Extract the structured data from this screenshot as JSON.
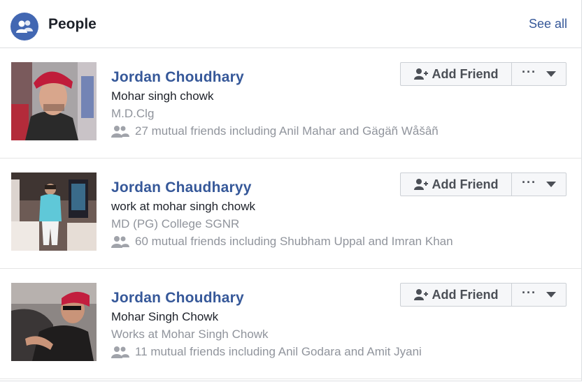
{
  "header": {
    "title": "People",
    "see_all": "See all"
  },
  "people": [
    {
      "name": "Jordan Choudhary",
      "line1": "Mohar singh chowk",
      "line2": "M.D.Clg",
      "mutual": "27 mutual friends including Anil Mahar and Gägäñ Wåšâñ",
      "add_friend_label": "Add Friend",
      "more_label": "···"
    },
    {
      "name": "Jordan Chaudharyy",
      "line1": "work at mohar singh chowk",
      "line2": "MD (PG) College SGNR",
      "mutual": "60 mutual friends including Shubham Uppal and Imran Khan",
      "add_friend_label": "Add Friend",
      "more_label": "···"
    },
    {
      "name": "Jordan Choudhary",
      "line1": "Mohar Singh Chowk",
      "line2": "Works at Mohar Singh Chowk",
      "mutual": "11 mutual friends including Anil Godara and Amit Jyani",
      "add_friend_label": "Add Friend",
      "more_label": "···"
    }
  ],
  "colors": {
    "link_blue": "#365899",
    "brand_blue": "#4267b2",
    "secondary_text": "#90949c",
    "button_bg": "#f6f7f9",
    "border": "#dddfe2"
  },
  "icons": {
    "header": "people-icon",
    "mutual": "mutual-friends-icon",
    "add": "add-friend-icon",
    "more": "more-dots-icon",
    "caret": "chevron-down-icon"
  }
}
